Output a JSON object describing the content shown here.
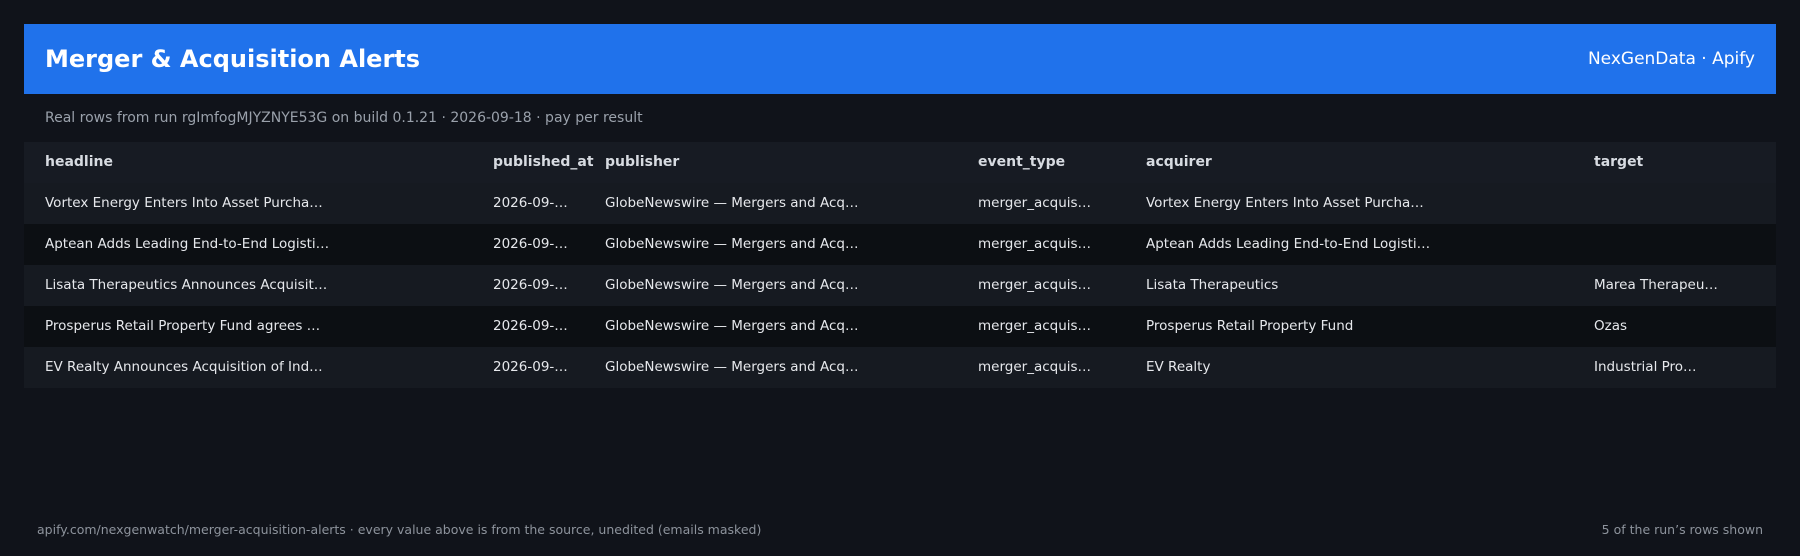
{
  "header": {
    "title": "Merger & Acquisition Alerts",
    "brand": "NexGenData · Apify"
  },
  "subtitle": "Real rows from run rgImfogMJYZNYE53G on build 0.1.21 · 2026-09-18 · pay per result",
  "table": {
    "columns": [
      "headline",
      "published_at",
      "publisher",
      "event_type",
      "acquirer",
      "target"
    ],
    "rows": [
      [
        "Vortex Energy Enters Into Asset Purcha…",
        "2026-09-…",
        "GlobeNewswire — Mergers and Acq…",
        "merger_acquis…",
        "Vortex Energy Enters Into Asset Purcha…",
        ""
      ],
      [
        "Aptean Adds Leading End-to-End Logisti…",
        "2026-09-…",
        "GlobeNewswire — Mergers and Acq…",
        "merger_acquis…",
        "Aptean Adds Leading End-to-End Logisti…",
        ""
      ],
      [
        "Lisata Therapeutics Announces Acquisit…",
        "2026-09-…",
        "GlobeNewswire — Mergers and Acq…",
        "merger_acquis…",
        "Lisata Therapeutics",
        "Marea Therapeu…"
      ],
      [
        "Prosperus Retail Property Fund agrees …",
        "2026-09-…",
        "GlobeNewswire — Mergers and Acq…",
        "merger_acquis…",
        "Prosperus Retail Property Fund",
        "Ozas"
      ],
      [
        "EV Realty Announces Acquisition of Ind…",
        "2026-09-…",
        "GlobeNewswire — Mergers and Acq…",
        "merger_acquis…",
        "EV Realty",
        "Industrial Pro…"
      ]
    ]
  },
  "footer": {
    "left": "apify.com/nexgenwatch/merger-acquisition-alerts  ·  every value above is from the source, unedited (emails masked)",
    "right": "5 of the run’s rows shown"
  },
  "colors": {
    "accent": "#2072eb",
    "background": "#10131a"
  }
}
